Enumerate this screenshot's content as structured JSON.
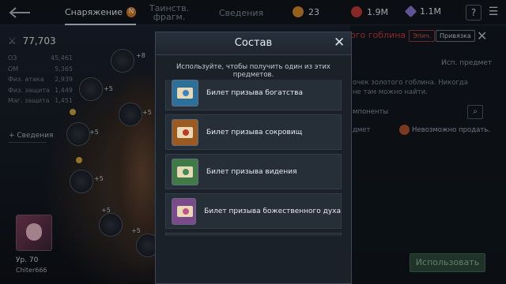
{
  "topbar": {
    "tabs": [
      {
        "label": "Снаряжение",
        "badge": "N"
      },
      {
        "label": "Таинств. фрагм."
      },
      {
        "label": "Сведения"
      }
    ],
    "resources": {
      "gold": "23",
      "ruby": "1.9M",
      "crystal": "1.1M"
    },
    "help_label": "?",
    "menu_label": "☰"
  },
  "stats": {
    "power": "77,703",
    "rows": [
      {
        "label": "ОЗ",
        "value": "45,461"
      },
      {
        "label": "ОМ",
        "value": "5,365"
      },
      {
        "label": "Физ. атака",
        "value": "2,939"
      },
      {
        "label": "Физ. защита",
        "value": "1,449"
      },
      {
        "label": "Маг. защита",
        "value": "1,451"
      }
    ],
    "details_label": "+ Сведения"
  },
  "slots": [
    {
      "lvl": "+8"
    },
    {
      "lvl": "+5"
    },
    {
      "lvl": "+5"
    },
    {
      "lvl": "+5"
    },
    {
      "lvl": "+5"
    },
    {
      "lvl": "+5"
    },
    {
      "lvl": "+5"
    }
  ],
  "player": {
    "level": "Ур. 70",
    "name": "Chiter666"
  },
  "item_panel": {
    "title": "ого гоблина",
    "tag_epic": "Эпич.",
    "tag_bind": "Привязка",
    "close": "✕",
    "use_label": "Исп. предмет",
    "description": "очек золотого гоблина. Никогда не там можно найти.",
    "components": "мпоненты",
    "item_label": "дмет",
    "no_sell": "Невозможно продать.",
    "use_button": "Использовать"
  },
  "modal": {
    "title": "Состав",
    "close": "✕",
    "subtitle": "Используйте, чтобы получить один из этих предметов.",
    "items": [
      {
        "label": "Билет призыва богатства",
        "color": "#2b6f9a",
        "seal": "#3a86c4"
      },
      {
        "label": "Билет призыва сокровищ",
        "color": "#9a5a22",
        "seal": "#c0392b"
      },
      {
        "label": "Билет призыва видения",
        "color": "#3f7a47",
        "seal": "#3c8c55"
      },
      {
        "label": "Билет призыва божественного духа",
        "color": "#7a4a8a",
        "seal": "#c0558c"
      },
      {
        "label": "",
        "color": "#2b6f9a",
        "seal": "#3a86c4"
      }
    ]
  }
}
